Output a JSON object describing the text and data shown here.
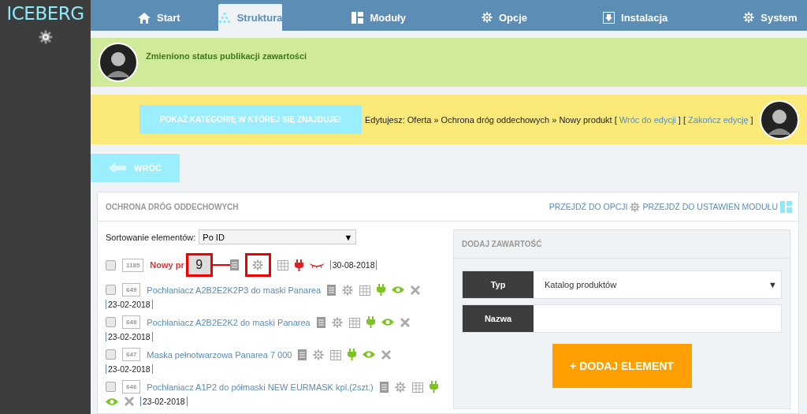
{
  "brand": "ICEBERG",
  "nav": [
    {
      "label": "Start",
      "selected": false
    },
    {
      "label": "Struktura",
      "selected": true
    },
    {
      "label": "Moduły",
      "selected": false
    },
    {
      "label": "Opcje",
      "selected": false
    },
    {
      "label": "Instalacja",
      "selected": false
    },
    {
      "label": "System",
      "selected": false
    }
  ],
  "notice": {
    "message": "Zmieniono status publikacji zawartości"
  },
  "edit_bar": {
    "show_category_button": "POKAŻ KATEGORIĘ W KTÓREJ SIĘ ZNAJDUJE!",
    "breadcrumb": "Edytujesz: Oferta » Ochrona dróg oddechowych » Nowy produkt [",
    "back_link": "Wróc do edycji",
    "middle": "] [",
    "finish_link": "Zakończ edycję",
    "end": "]"
  },
  "back_button": "WRÓĆ",
  "panel": {
    "title": "OCHRONA DRÓG ODDECHOWYCH",
    "options_link": "PRZEJDŹ DO OPCJI",
    "module_link": "PRZEJDŹ DO USTAWIEŃ MODUŁU"
  },
  "sorting": {
    "label": "Sortowanie elementów:",
    "value": "Po ID",
    "arrow": "▼"
  },
  "items": [
    {
      "id": "1185",
      "title": "Nowy pr",
      "published": false,
      "new": true,
      "checked": false,
      "date": "30-08-2018",
      "callout": "9"
    },
    {
      "id": "649",
      "title": "Pochłaniacz A2B2E2K2P3 do maski Panarea",
      "published": true,
      "new": false,
      "checked": false,
      "date": "23-02-2018"
    },
    {
      "id": "648",
      "title": "Pochłaniacz A2B2E2K2 do maski Panarea",
      "published": true,
      "new": false,
      "checked": false,
      "date": "23-02-2018"
    },
    {
      "id": "647",
      "title": "Maska pełnotwarzowa Panarea 7 000",
      "published": true,
      "new": false,
      "checked": false,
      "date": "23-02-2018"
    },
    {
      "id": "646",
      "title": "Pochłaniacz A1P2 do półmaski NEW EURMASK kpl.(2szt.)",
      "published": true,
      "new": false,
      "checked": false,
      "date": "23-02-2018"
    }
  ],
  "add_content": {
    "title": "DODAJ ZAWARTOŚĆ",
    "type_label": "Typ",
    "type_value": "Katalog produktów",
    "type_arrow": "▼",
    "name_label": "Nazwa",
    "button": "+ DODAJ ELEMENT"
  }
}
